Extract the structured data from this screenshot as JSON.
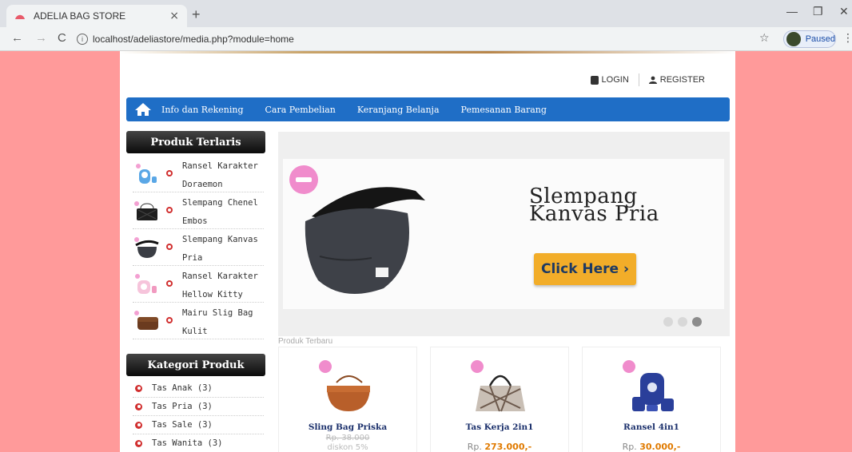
{
  "browser": {
    "tab_title": "ADELIA BAG STORE",
    "tab_close": "×",
    "new_tab": "+",
    "url": "localhost/adeliastore/media.php?module=home",
    "paused_label": "Paused",
    "controls": {
      "back": "←",
      "forward": "→",
      "reload": "C",
      "info": "i",
      "star": "☆",
      "menu": "⋮",
      "minimize": "—",
      "maximize": "❐",
      "close": "✕"
    }
  },
  "header": {
    "login": "LOGIN",
    "register": "REGISTER"
  },
  "nav": {
    "items": [
      "Info dan Rekening",
      "Cara Pembelian",
      "Keranjang Belanja",
      "Pemesanan Barang"
    ]
  },
  "sidebar": {
    "best_title": "Produk Terlaris",
    "best": [
      {
        "line1": "Ransel Karakter",
        "line2": "Doraemon"
      },
      {
        "line1": "Slempang Chenel",
        "line2": "Embos"
      },
      {
        "line1": "Slempang Kanvas",
        "line2": "Pria"
      },
      {
        "line1": "Ransel Karakter",
        "line2": "Hellow Kitty"
      },
      {
        "line1": "Mairu Slig Bag",
        "line2": "Kulit"
      }
    ],
    "category_title": "Kategori Produk",
    "categories": [
      "Tas Anak (3)",
      "Tas Pria (3)",
      "Tas Sale (3)",
      "Tas Wanita (3)"
    ]
  },
  "slider": {
    "title_line1": "Slempang",
    "title_line2": "Kanvas Pria",
    "button": "Click Here ›",
    "dot_count": 3,
    "active_dot": 3
  },
  "latest": {
    "label": "Produk Terbaru",
    "products": [
      {
        "name": "Sling Bag Priska",
        "old_price": "Rp. 38.000",
        "discount": "diskon 5%"
      },
      {
        "name": "Tas Kerja 2in1",
        "price_prefix": "Rp. ",
        "price": "273.000,-"
      },
      {
        "name": "Ransel 4in1",
        "price_prefix": "Rp. ",
        "price": "30.000,-"
      }
    ]
  },
  "colors": {
    "nav": "#1f6ec6",
    "page_bg": "#ff9a9a",
    "button": "#f2ad29",
    "accent_red": "#d12f2f"
  }
}
